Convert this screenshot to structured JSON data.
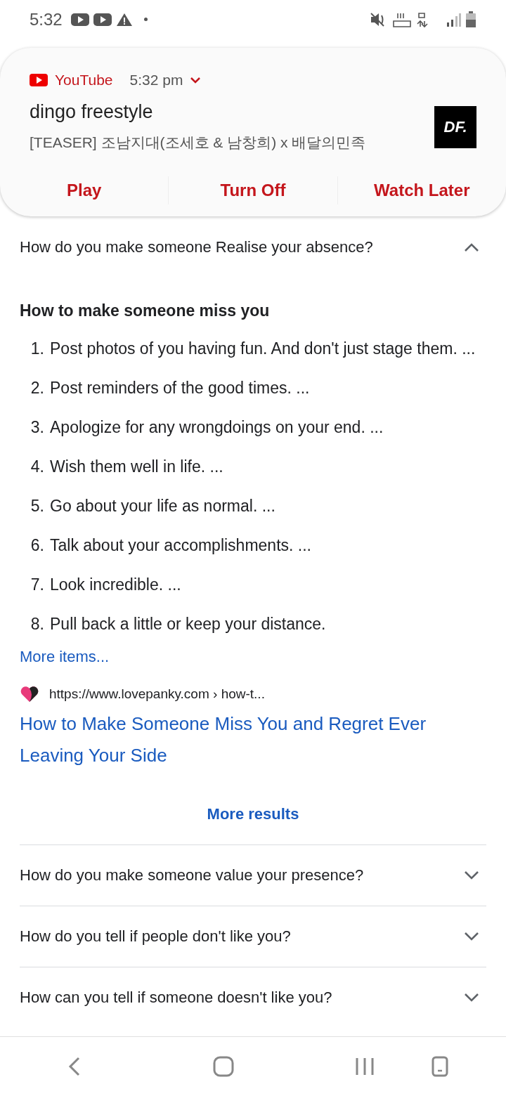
{
  "status_bar": {
    "time": "5:32"
  },
  "notification": {
    "app": "YouTube",
    "time": "5:32 pm",
    "title": "dingo freestyle",
    "text": "[TEASER] 조남지대(조세호 & 남창희) x 배달의민족",
    "thumbnail_text": "DF.",
    "actions": [
      "Play",
      "Turn Off",
      "Watch Later"
    ]
  },
  "open_question": {
    "text": "How do you make someone Realise your absence?",
    "expanded": true
  },
  "answer": {
    "heading": "How to make someone miss you",
    "items": [
      {
        "number": "1.",
        "text": "Post photos of you having fun. And don't just stage them. ..."
      },
      {
        "number": "2.",
        "text": "Post reminders of the good times. ..."
      },
      {
        "number": "3.",
        "text": "Apologize for any wrongdoings on your end. ..."
      },
      {
        "number": "4.",
        "text": "Wish them well in life. ..."
      },
      {
        "number": "5.",
        "text": "Go about your life as normal. ..."
      },
      {
        "number": "6.",
        "text": "Talk about your accomplishments. ..."
      },
      {
        "number": "7.",
        "text": "Look incredible. ..."
      },
      {
        "number": "8.",
        "text": "Pull back a little or keep your distance."
      }
    ],
    "more_items": "More items...",
    "source_url": "https://www.lovepanky.com › how-t...",
    "source_title": "How to Make Someone Miss You and Regret Ever Leaving Your Side"
  },
  "more_results": "More results",
  "questions": [
    {
      "text": "How do you make someone value your presence?",
      "expanded": false
    },
    {
      "text": "How do you tell if people don't like you?",
      "expanded": false
    },
    {
      "text": "How can you tell if someone doesn't like you?",
      "expanded": false
    }
  ]
}
